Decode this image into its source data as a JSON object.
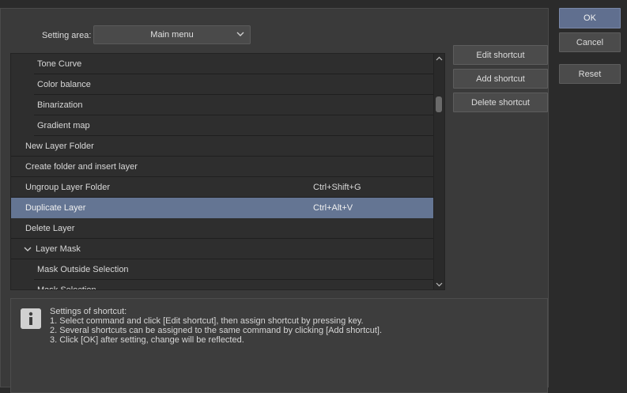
{
  "setting_area": {
    "label": "Setting area:",
    "selected": "Main menu"
  },
  "commands": [
    {
      "label": "Tone Curve",
      "shortcut": "",
      "indent": 2,
      "selected": false
    },
    {
      "label": "Color balance",
      "shortcut": "",
      "indent": 2,
      "selected": false
    },
    {
      "label": "Binarization",
      "shortcut": "",
      "indent": 2,
      "selected": false
    },
    {
      "label": "Gradient map",
      "shortcut": "",
      "indent": 2,
      "selected": false
    },
    {
      "label": "New Layer Folder",
      "shortcut": "",
      "indent": 1,
      "selected": false
    },
    {
      "label": "Create folder and insert layer",
      "shortcut": "",
      "indent": 1,
      "selected": false
    },
    {
      "label": "Ungroup Layer Folder",
      "shortcut": "Ctrl+Shift+G",
      "indent": 1,
      "selected": false
    },
    {
      "label": "Duplicate Layer",
      "shortcut": "Ctrl+Alt+V",
      "indent": 1,
      "selected": true
    },
    {
      "label": "Delete Layer",
      "shortcut": "",
      "indent": 1,
      "selected": false
    },
    {
      "label": "Layer Mask",
      "shortcut": "",
      "indent": 1,
      "selected": false,
      "expandable": true
    },
    {
      "label": "Mask Outside Selection",
      "shortcut": "",
      "indent": 2,
      "selected": false
    },
    {
      "label": "Mask Selection",
      "shortcut": "",
      "indent": 2,
      "selected": false
    }
  ],
  "actions": {
    "edit": "Edit shortcut",
    "add": "Add shortcut",
    "delete": "Delete shortcut"
  },
  "dialog": {
    "ok": "OK",
    "cancel": "Cancel",
    "reset": "Reset"
  },
  "help": {
    "title": "Settings of shortcut:",
    "line1": "1. Select command and click [Edit shortcut], then assign shortcut by pressing key.",
    "line2": "2. Several shortcuts can be assigned to the same command by clicking [Add shortcut].",
    "line3": "3. Click [OK] after setting, change will be reflected."
  },
  "colors": {
    "selected_row": "#647593",
    "primary_button": "#606f8f"
  }
}
